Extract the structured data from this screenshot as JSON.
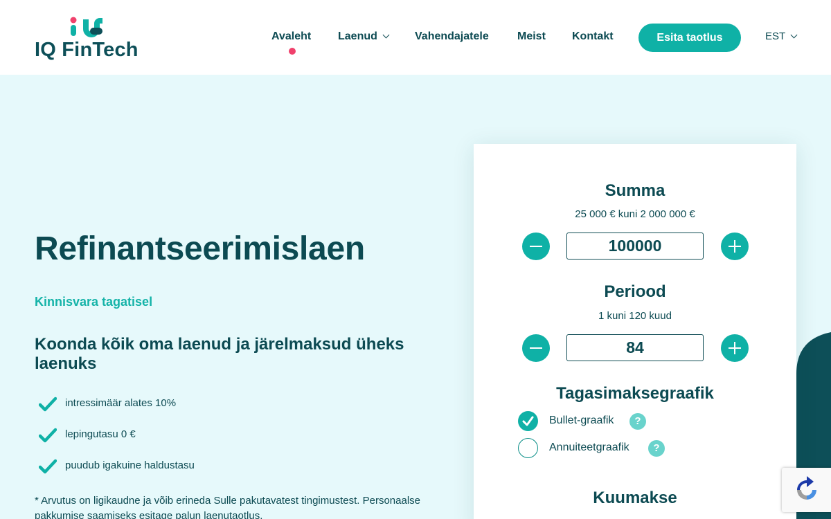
{
  "brand": {
    "name": "IQ FinTech",
    "accent": "#0fb1a6",
    "dark": "#0c4a52",
    "pink": "#f0416c"
  },
  "nav": {
    "items": [
      {
        "label": "Avaleht",
        "active": true
      },
      {
        "label": "Laenud",
        "dropdown": true
      },
      {
        "label": "Vahendajatele"
      },
      {
        "label": "Meist"
      },
      {
        "label": "Kontakt"
      }
    ],
    "cta": "Esita taotlus",
    "language": "EST"
  },
  "hero": {
    "title": "Refinantseerimislaen",
    "subtitle": "Kinnisvara tagatisel",
    "heading": "Koonda kõik oma laenud ja järelmaksud üheks laenuks",
    "features": [
      "intressimäär alates 10%",
      "lepingutasu 0 €",
      "puudub igakuine haldustasu"
    ],
    "note": "* Arvutus on ligikaudne ja võib erineda Sulle pakutavatest tingimustest. Personaalse pakkumise saamiseks esitage palun laenutaotlus."
  },
  "calculator": {
    "amount": {
      "title": "Summa",
      "range": "25 000 € kuni 2 000 000 €",
      "value": "100000"
    },
    "period": {
      "title": "Periood",
      "range": "1 kuni 120 kuud",
      "value": "84"
    },
    "schedule": {
      "title": "Tagasimaksegraafik",
      "options": [
        {
          "label": "Bullet-graafik",
          "checked": true
        },
        {
          "label": "Annuiteetgraafik",
          "checked": false
        }
      ],
      "help_label": "?"
    },
    "monthly": {
      "title": "Kuumakse"
    }
  },
  "icons": {
    "check": "check-icon",
    "minus": "minus-icon",
    "plus": "plus-icon",
    "help": "question-icon",
    "chevron": "chevron-down-icon",
    "recaptcha": "recaptcha-icon"
  }
}
